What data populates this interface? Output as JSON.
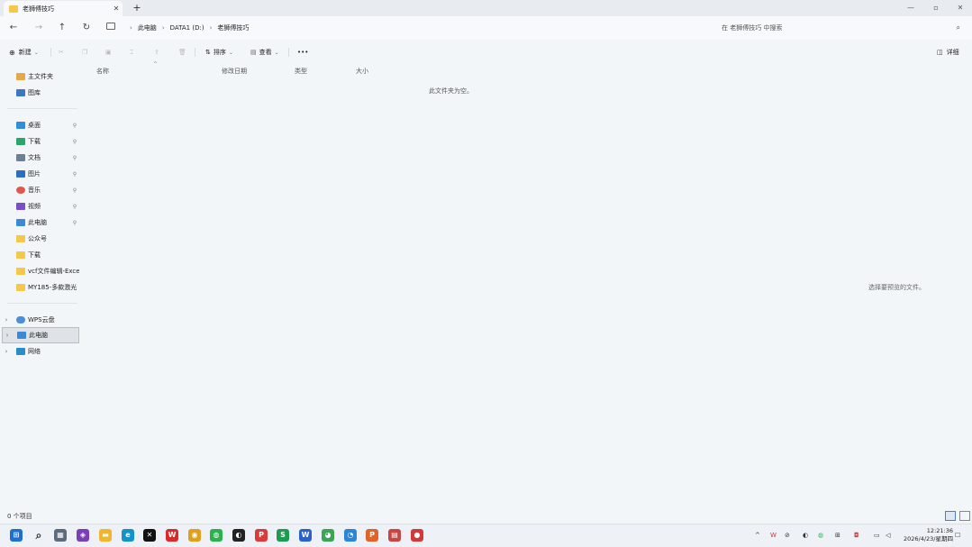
{
  "window": {
    "tab_title": "老狮傅技巧",
    "new_tab": "+",
    "tab_close": "✕",
    "minimize": "—",
    "maximize": "▫",
    "close": "✕"
  },
  "nav": {
    "back": "←",
    "forward": "→",
    "up": "↑",
    "refresh": "↻",
    "breadcrumbs": [
      "此电脑",
      "DATA1 (D:)",
      "老狮傅技巧"
    ],
    "crumb_sep": "›",
    "search_placeholder": "在 老狮傅技巧 中搜索",
    "search_icon": "⌕"
  },
  "toolbar": {
    "new_label": "新建",
    "sort_label": "排序",
    "view_label": "查看",
    "more": "•••",
    "details_label": "详细",
    "icons": [
      "cut-icon",
      "copy-icon",
      "paste-icon",
      "rename-icon",
      "share-icon",
      "delete-icon"
    ]
  },
  "columns": {
    "name": "名称",
    "modified": "修改日期",
    "type": "类型",
    "size": "大小",
    "sort_hint": "^"
  },
  "messages": {
    "empty_folder": "此文件夹为空。",
    "preview": "选择要预览的文件。"
  },
  "sidebar": {
    "items": [
      {
        "label": "主文件夹",
        "icon": "home-icon",
        "pinned": false,
        "expander": ""
      },
      {
        "label": "图库",
        "icon": "gallery-icon",
        "pinned": false,
        "expander": ""
      },
      {
        "label": "桌面",
        "icon": "desktop-icon",
        "pinned": true,
        "expander": ""
      },
      {
        "label": "下载",
        "icon": "download-icon",
        "pinned": true,
        "expander": ""
      },
      {
        "label": "文档",
        "icon": "document-icon",
        "pinned": true,
        "expander": ""
      },
      {
        "label": "图片",
        "icon": "picture-icon",
        "pinned": true,
        "expander": ""
      },
      {
        "label": "音乐",
        "icon": "music-icon",
        "pinned": true,
        "expander": ""
      },
      {
        "label": "视频",
        "icon": "video-icon",
        "pinned": true,
        "expander": ""
      },
      {
        "label": "此电脑",
        "icon": "pc-icon",
        "pinned": true,
        "expander": ""
      },
      {
        "label": "公众号",
        "icon": "folder-icon",
        "pinned": false,
        "expander": ""
      },
      {
        "label": "下载",
        "icon": "folder-icon",
        "pinned": false,
        "expander": ""
      },
      {
        "label": "vcf文件编辑-Excel",
        "icon": "folder-icon",
        "pinned": false,
        "expander": ""
      },
      {
        "label": "MY185-多款激光",
        "icon": "folder-icon",
        "pinned": false,
        "expander": ""
      },
      {
        "label": "WPS云盘",
        "icon": "cloud-icon",
        "pinned": false,
        "expander": "›"
      },
      {
        "label": "此电脑",
        "icon": "pc-icon",
        "pinned": false,
        "expander": "›"
      },
      {
        "label": "网络",
        "icon": "network-icon",
        "pinned": false,
        "expander": "›"
      }
    ],
    "pin_glyph": "⚲"
  },
  "status": {
    "item_count": "0 个项目"
  },
  "taskbar": {
    "apps": [
      {
        "name": "start-icon",
        "glyph": "⊞",
        "color": "#1f6fd1"
      },
      {
        "name": "search-icon",
        "glyph": "⌕",
        "color": "#333333"
      },
      {
        "name": "calculator-icon",
        "glyph": "▦",
        "color": "#5b6b7d"
      },
      {
        "name": "app-purple-icon",
        "glyph": "◈",
        "color": "#7b3fb8"
      },
      {
        "name": "file-explorer-icon",
        "glyph": "▬",
        "color": "#f2b62c"
      },
      {
        "name": "edge-icon",
        "glyph": "e",
        "color": "#1493c9"
      },
      {
        "name": "capcut-icon",
        "glyph": "✕",
        "color": "#111111"
      },
      {
        "name": "wps-icon",
        "glyph": "W",
        "color": "#d92b2b"
      },
      {
        "name": "chrome-icon",
        "glyph": "◉",
        "color": "#e0a01c"
      },
      {
        "name": "wechat-icon",
        "glyph": "◍",
        "color": "#2bb24c"
      },
      {
        "name": "qq-icon",
        "glyph": "◐",
        "color": "#222222"
      },
      {
        "name": "wps-pdf-icon",
        "glyph": "P",
        "color": "#d93a3a"
      },
      {
        "name": "wps-sheet-icon",
        "glyph": "S",
        "color": "#1d9b50"
      },
      {
        "name": "word-icon",
        "glyph": "W",
        "color": "#2a62c9"
      },
      {
        "name": "app-green-icon",
        "glyph": "◕",
        "color": "#3aa655"
      },
      {
        "name": "app-blue-icon",
        "glyph": "◔",
        "color": "#2a86d6"
      },
      {
        "name": "ppt-icon",
        "glyph": "P",
        "color": "#e0632a"
      },
      {
        "name": "calendar-icon",
        "glyph": "▤",
        "color": "#c94444"
      },
      {
        "name": "recorder-icon",
        "glyph": "●",
        "color": "#d23a3a"
      }
    ],
    "time": "12:21:36",
    "date": "2026/4/23/星期四"
  }
}
